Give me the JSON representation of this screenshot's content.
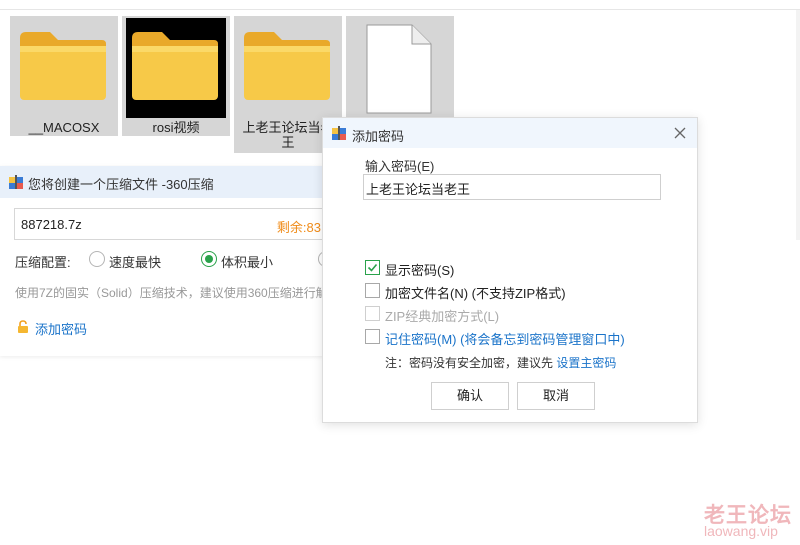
{
  "files": [
    {
      "name": "__MACOSX",
      "type": "folder"
    },
    {
      "name": "rosi视频",
      "type": "folder"
    },
    {
      "name": "上老王论坛当老王",
      "type": "folder"
    },
    {
      "name": "",
      "type": "document"
    }
  ],
  "archive_window": {
    "title": "您将创建一个压缩文件 -360压缩",
    "file_name": "887218.7z",
    "remaining": "剩余:83",
    "config_label": "压缩配置:",
    "options": [
      "速度最快",
      "体积最小"
    ],
    "selected_option": "体积最小",
    "description": "使用7Z的固实（Solid）压缩技术，建议使用360压缩进行解压",
    "add_password": "添加密码"
  },
  "dialog": {
    "title": "添加密码",
    "password_label": "输入密码(E)",
    "password_value": "上老王论坛当老王",
    "checkboxes": [
      {
        "label": "显示密码(S)",
        "checked": true,
        "disabled": false
      },
      {
        "label": "加密文件名(N) (不支持ZIP格式)",
        "checked": false,
        "disabled": false
      },
      {
        "label": "ZIP经典加密方式(L)",
        "checked": false,
        "disabled": true
      },
      {
        "label": "记住密码(M) (将会备忘到密码管理窗口中)",
        "checked": false,
        "disabled": false
      }
    ],
    "note": "注：密码没有安全加密，建议先",
    "note_link": "设置主密码",
    "ok": "确认",
    "cancel": "取消"
  },
  "watermark": {
    "line1": "老王论坛",
    "line2": "laowang.vip"
  },
  "colors": {
    "accent_green": "#2aa24b",
    "link_blue": "#1a73c9",
    "remain_orange": "#f08c1a",
    "folder_yellow": "#f7c948"
  }
}
